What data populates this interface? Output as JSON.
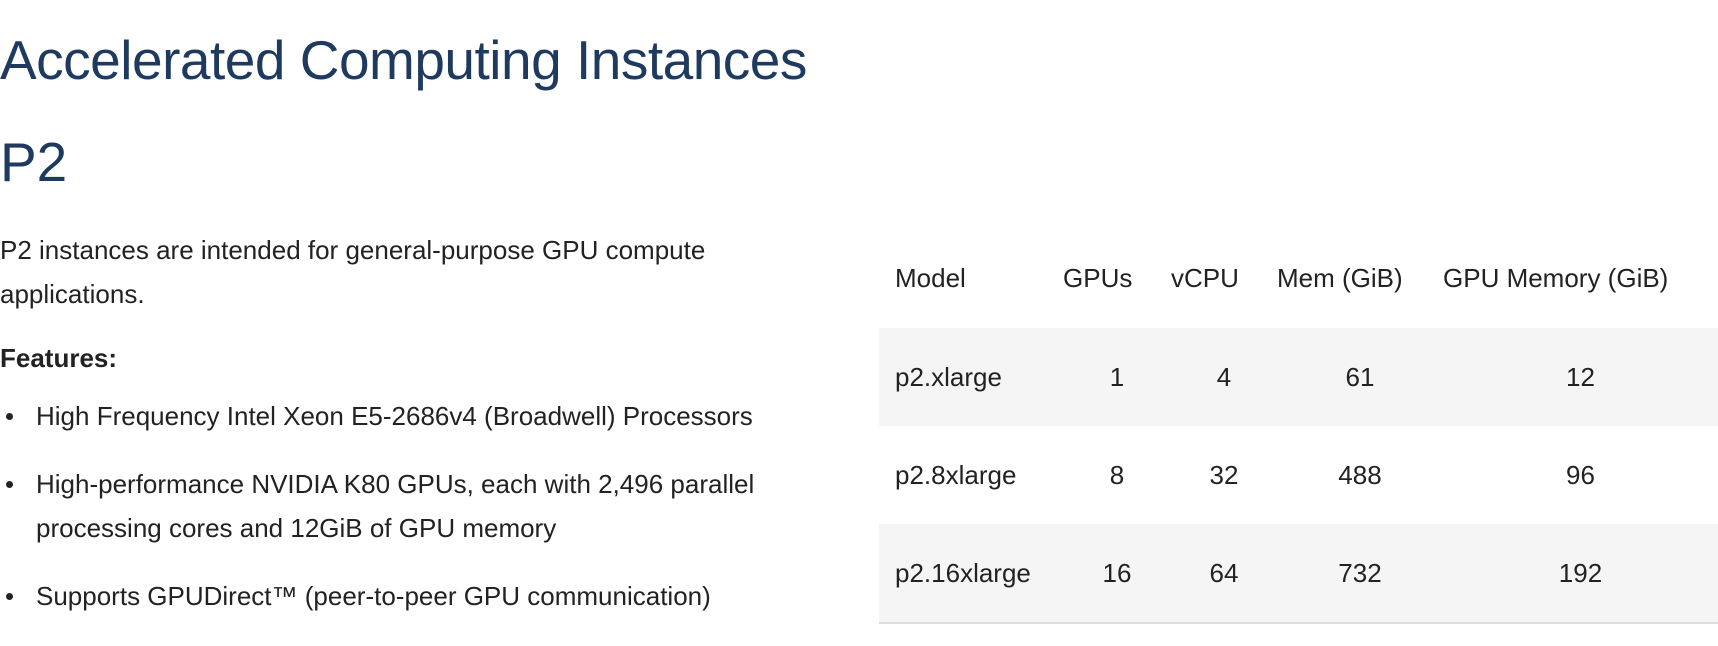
{
  "header": {
    "title": "Accelerated Computing Instances"
  },
  "section": {
    "title": "P2",
    "intro": "P2 instances are intended for general-purpose GPU compute applications.",
    "features_label": "Features:",
    "features": [
      "High Frequency Intel Xeon E5-2686v4 (Broadwell) Processors",
      "High-performance NVIDIA K80 GPUs, each with 2,496 parallel processing cores and 12GiB of GPU memory",
      "Supports GPUDirect™ (peer-to-peer GPU communication)"
    ]
  },
  "table": {
    "columns": [
      "Model",
      "GPUs",
      "vCPU",
      "Mem (GiB)",
      "GPU Memory (GiB)"
    ],
    "rows": [
      [
        "p2.xlarge",
        "1",
        "4",
        "61",
        "12"
      ],
      [
        "p2.8xlarge",
        "8",
        "32",
        "488",
        "96"
      ],
      [
        "p2.16xlarge",
        "16",
        "64",
        "732",
        "192"
      ]
    ]
  },
  "colors": {
    "heading": "#1f3a5f",
    "text": "#222222",
    "row_stripe": "#f5f5f5"
  }
}
